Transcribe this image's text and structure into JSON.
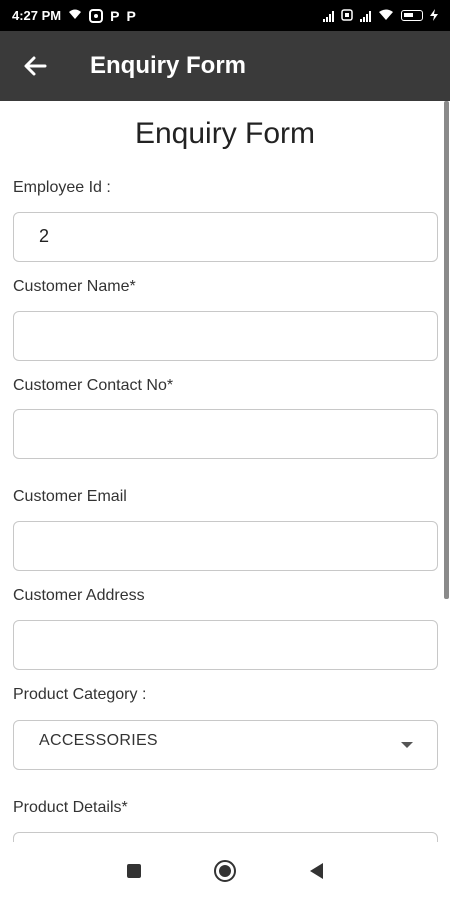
{
  "status_bar": {
    "time": "4:27 PM",
    "left_icons": [
      "wifi-icon",
      "camera-icon",
      "p-icon",
      "p-icon"
    ],
    "right_icons": [
      "signal-icon",
      "sim-icon",
      "signal-icon",
      "wifi-icon",
      "battery-icon",
      "charging-icon"
    ]
  },
  "app_bar": {
    "title": "Enquiry Form",
    "back_icon": "arrow-left-icon"
  },
  "form": {
    "title": "Enquiry Form",
    "employee_id_label": "Employee Id :",
    "employee_id_value": "2",
    "customer_name_label": "Customer Name*",
    "customer_name_value": "",
    "customer_contact_label": "Customer Contact No*",
    "customer_contact_value": "",
    "customer_email_label": "Customer Email",
    "customer_email_value": "",
    "customer_address_label": "Customer Address",
    "customer_address_value": "",
    "product_category_label": "Product Category :",
    "product_category_selected": "ACCESSORIES",
    "product_details_label": "Product Details*",
    "product_details_value": ""
  },
  "nav_bar": {
    "icons": [
      "recents-square-icon",
      "home-circle-icon",
      "back-triangle-icon"
    ]
  },
  "colors": {
    "app_bar": "#3a3a3a",
    "status_bar": "#000000",
    "field_border": "#c8c8c8"
  }
}
